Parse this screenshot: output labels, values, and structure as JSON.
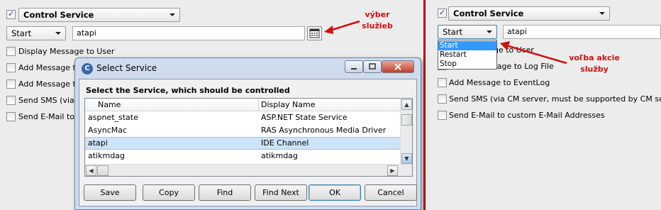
{
  "left_panel": {
    "action_combo": "Control Service",
    "mode_combo": "Start",
    "service_value": "atapi",
    "options": [
      {
        "label": "Display Message to User",
        "checked": false
      },
      {
        "label": "Add Message to",
        "checked": false
      },
      {
        "label": "Add Message to",
        "checked": false
      },
      {
        "label": "Send SMS (via C",
        "checked": false
      },
      {
        "label": "Send E-Mail to c",
        "checked": false
      }
    ]
  },
  "right_panel": {
    "action_combo": "Control Service",
    "mode_combo": "Start",
    "service_value": "atapi",
    "mode_options": [
      "Start",
      "Restart",
      "Stop"
    ],
    "selected_mode": "Start",
    "options": [
      {
        "label": "ge to User",
        "checked": false
      },
      {
        "label": "Message to Log File",
        "checked": false
      },
      {
        "label": "Add Message to EventLog",
        "checked": false
      },
      {
        "label": "Send SMS (via CM server, must be supported by CM server)",
        "checked": false
      },
      {
        "label": "Send E-Mail to custom E-Mail Addresses",
        "checked": false
      }
    ]
  },
  "annotations": {
    "left": "výber\nslužieb",
    "right": "voľba akcie\nslužby"
  },
  "dialog": {
    "title": "Select Service",
    "heading": "Select the Service, which should be controlled",
    "columns": [
      "Name",
      "Display Name"
    ],
    "rows": [
      {
        "name": "aspnet_state",
        "display": "ASP.NET State Service",
        "selected": false
      },
      {
        "name": "AsyncMac",
        "display": "RAS Asynchronous Media Driver",
        "selected": false
      },
      {
        "name": "atapi",
        "display": "IDE Channel",
        "selected": true
      },
      {
        "name": "atikmdag",
        "display": "atikmdag",
        "selected": false
      }
    ],
    "buttons": [
      "Save",
      "Copy",
      "Find",
      "Find Next",
      "OK",
      "Cancel"
    ]
  },
  "colors": {
    "annotation": "#d01010",
    "divider": "#c00000",
    "selection": "#cde3f7",
    "dropdown_highlight": "#3399ff"
  }
}
